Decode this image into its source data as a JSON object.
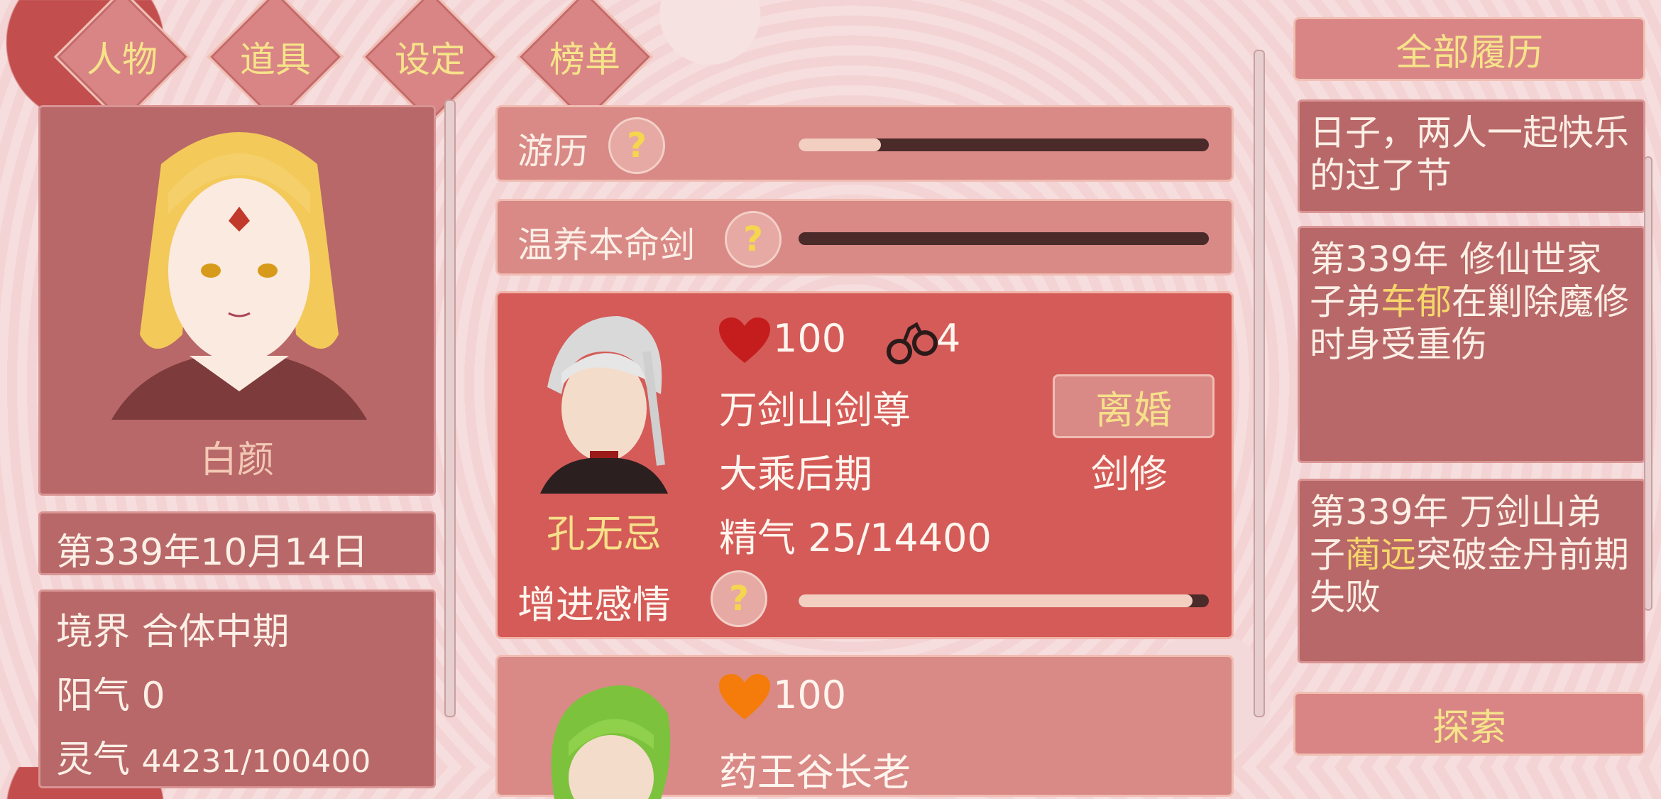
{
  "tabs": [
    {
      "label": "人物"
    },
    {
      "label": "道具"
    },
    {
      "label": "设定"
    },
    {
      "label": "榜单"
    }
  ],
  "player": {
    "name": "白颜",
    "date": "第339年10月14日",
    "stats": {
      "realm": "境界 合体中期",
      "yang": "阳气 0",
      "qi_label": "灵气",
      "qi_value": "44231/100400"
    }
  },
  "actions": [
    {
      "label": "游历",
      "progress": 0.2
    },
    {
      "label": "温养本命剑",
      "progress": 0.0
    }
  ],
  "partners": [
    {
      "name": "孔无忌",
      "heart_color": "#c51d1d",
      "favor": "100",
      "handcuff_count": "4",
      "title": "万剑山剑尊",
      "realm": "大乘后期",
      "essence": "精气 25/14400",
      "divorce_label": "离婚",
      "class": "剑修",
      "action_label": "增进感情",
      "action_progress": 0.96
    },
    {
      "heart_color": "#f57c0a",
      "favor": "100",
      "title": "药王谷长老"
    }
  ],
  "history": {
    "button": "全部履历",
    "entries": [
      {
        "text": "日子，两人一起快乐的过了节"
      },
      {
        "pre": "第339年 修仙世家子弟",
        "highlight": "车郁",
        "post": "在剿除魔修时身受重伤"
      },
      {
        "pre": "第339年 万剑山弟子",
        "highlight": "蔺远",
        "post": "突破金丹前期失败"
      }
    ]
  },
  "explore_label": "探索",
  "icons": [
    "question-icon",
    "heart-icon",
    "handcuffs-icon"
  ]
}
